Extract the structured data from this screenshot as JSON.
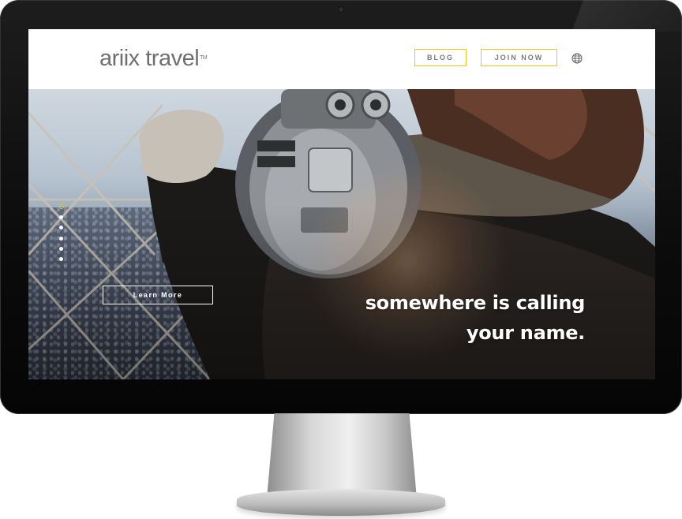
{
  "header": {
    "logo_text": "ariix travel",
    "logo_tm": "TM",
    "nav": {
      "blog_label": "BLOG",
      "join_label": "JOIN NOW"
    },
    "globe_icon": "globe-icon"
  },
  "hero": {
    "cta_label": "Learn More",
    "tagline_line1": "somewhere is calling",
    "tagline_line2": "your name.",
    "slider": {
      "count": 6,
      "active_index": 0
    }
  },
  "colors": {
    "accent": "#f2c21d",
    "logo_text": "#6f6f6f"
  }
}
